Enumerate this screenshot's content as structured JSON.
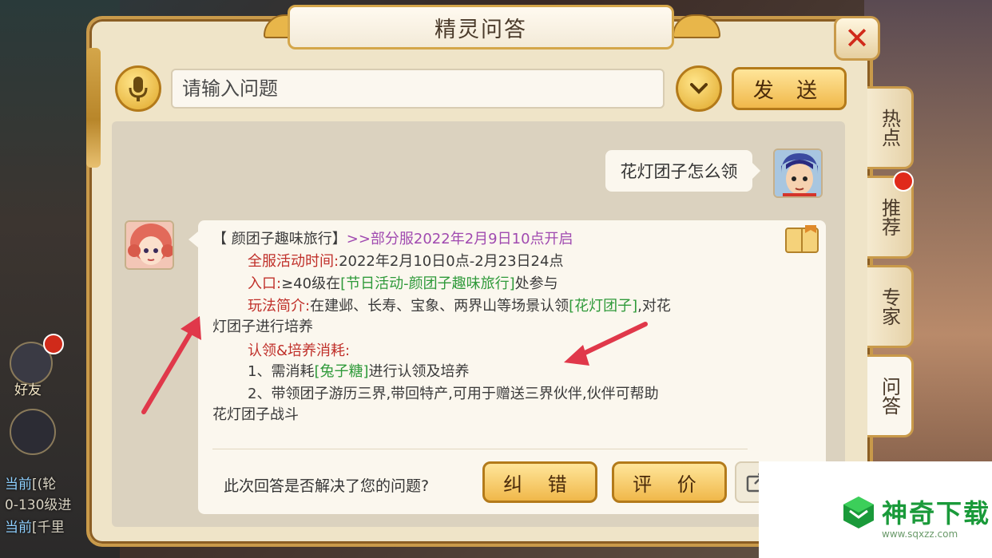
{
  "window": {
    "title": "精灵问答",
    "close_icon": "close-x-icon"
  },
  "input": {
    "placeholder": "请输入问题",
    "value": ""
  },
  "toolbar": {
    "send_label": "发 送",
    "mic_icon": "microphone-icon",
    "dropdown_icon": "chevron-down-icon"
  },
  "user_message": {
    "text": "花灯团子怎么领"
  },
  "answer": {
    "title": "【 颜团子趣味旅行】",
    "notice": ">>部分服2022年2月9日10点开启",
    "time_label": "全服活动时间:",
    "time_value": "2022年2月10日0点-2月23日24点",
    "entry_label": "入口:",
    "entry_pre": "≥40级在",
    "entry_link": "[节日活动-颜团子趣味旅行]",
    "entry_post": "处参与",
    "play_label": "玩法简介:",
    "play_pre": "在建邺、长寿、宝象、两界山等场景认领",
    "play_link": "[花灯团子]",
    "play_post": ",对花",
    "play_line2": "灯团子进行培养",
    "cost_label": "认领&培养消耗:",
    "cost1_pre": "1、需消耗",
    "cost1_link": "[兔子糖]",
    "cost1_post": "进行认领及培养",
    "cost2": "2、带领团子游历三界,带回特产,可用于赠送三界伙伴,伙伴可帮助",
    "cost2_line2": "花灯团子战斗"
  },
  "feedback": {
    "question": "此次回答是否解决了您的问题?",
    "correct_label": "纠 错",
    "rate_label": "评 价",
    "share_icon": "share-icon"
  },
  "side_tabs": [
    {
      "label": "热点"
    },
    {
      "label": "推荐"
    },
    {
      "label": "专家"
    },
    {
      "label": "问答"
    }
  ],
  "background": {
    "friends_label": "好友",
    "chat_lines": [
      {
        "channel": "当前",
        "text": "[(轮"
      },
      {
        "channel": "",
        "text": "0-130级进"
      },
      {
        "channel": "当前",
        "text": "[千里"
      }
    ]
  },
  "watermark": {
    "text": "神奇下载",
    "site": "www.sqxzz.com"
  },
  "colors": {
    "accent_gold": "#f0b84a",
    "link_green": "#2f9a3a",
    "label_red": "#c0302a",
    "notice_purple": "#a04ab0"
  }
}
